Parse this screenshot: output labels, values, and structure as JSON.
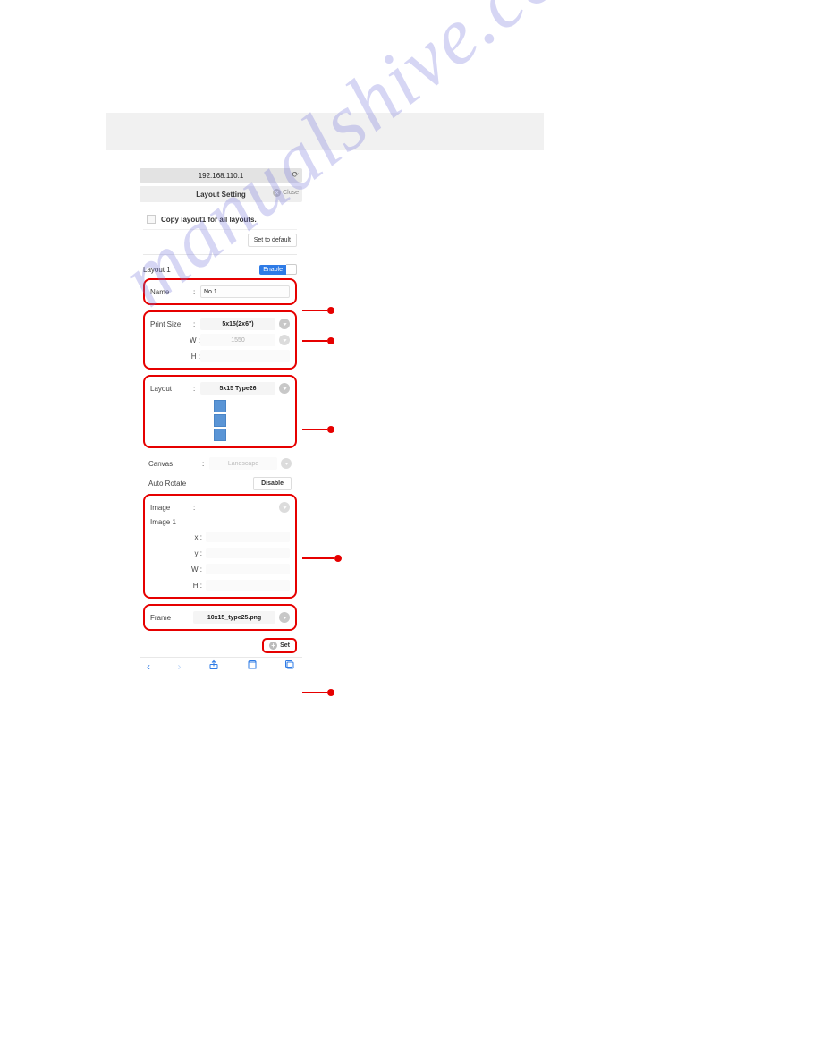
{
  "watermark": "manualshive.com",
  "browser": {
    "url": "192.168.110.1"
  },
  "header": {
    "title": "Layout Setting",
    "close_label": "Close"
  },
  "copy": {
    "label": "Copy layout1 for all layouts.",
    "default_btn": "Set to default"
  },
  "layout": {
    "name_header": "Layout 1",
    "enable_label": "Enable"
  },
  "name_row": {
    "label": "Name",
    "value": "No.1"
  },
  "printsize": {
    "label": "Print Size",
    "value": "5x15(2x6\")",
    "w_label": "W :",
    "w_value": "1550",
    "h_label": "H :"
  },
  "layout_sel": {
    "label": "Layout",
    "value": "5x15 Type26"
  },
  "canvas": {
    "label": "Canvas",
    "value": "Landscape"
  },
  "autorotate": {
    "label": "Auto Rotate",
    "btn": "Disable"
  },
  "image": {
    "label": "Image",
    "sub": "Image 1",
    "x_label": "x :",
    "y_label": "y :",
    "w_label": "W :",
    "h_label": "H :"
  },
  "frame": {
    "label": "Frame",
    "value": "10x15_type25.png"
  },
  "set_btn": "Set"
}
